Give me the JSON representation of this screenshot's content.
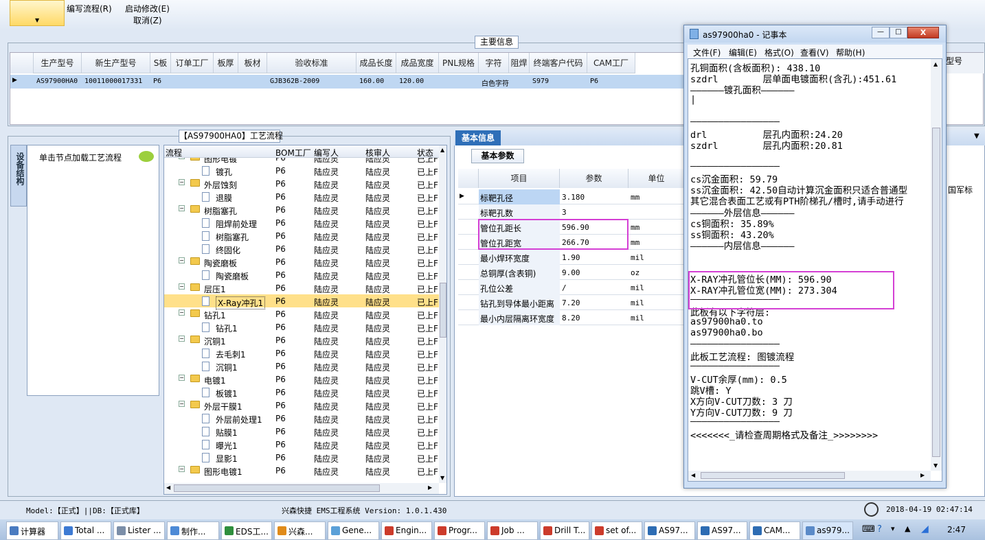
{
  "toolbar": {
    "write_flow": "编写流程(R)",
    "start_modify": "启动修改(E)",
    "cancel": "取消(Z)"
  },
  "main_info": {
    "tab": "主要信息",
    "columns": [
      "生产型号",
      "新生产型号",
      "S板",
      "订单工厂",
      "板厚",
      "板材",
      "验收标准",
      "成品长度",
      "成品宽度",
      "PNL规格",
      "字符",
      "阻焊",
      "终端客户代码",
      "CAM工厂",
      "型号"
    ],
    "row": [
      "AS97900HA0",
      "10011000017331",
      "P6",
      "",
      "",
      "",
      "GJB362B-2009",
      "160.00",
      "120.00",
      "",
      "白色字符",
      "",
      "S979",
      "P6",
      ""
    ]
  },
  "process": {
    "tab": "【AS97900HA0】工艺流程",
    "side_tab": "设备结构",
    "hint": "单击节点加载工艺流程",
    "columns": [
      "流程",
      "BOM工厂",
      "编写人",
      "核审人",
      "状态"
    ],
    "rows": [
      {
        "name": "图形电镀",
        "level": 0,
        "folder": true,
        "bom": "P6",
        "w": "陆应灵",
        "r": "陆应灵",
        "s": "已上F"
      },
      {
        "name": "镀孔",
        "level": 1,
        "folder": false,
        "bom": "P6",
        "w": "陆应灵",
        "r": "陆应灵",
        "s": "已上F"
      },
      {
        "name": "外层蚀刻",
        "level": 0,
        "folder": true,
        "bom": "P6",
        "w": "陆应灵",
        "r": "陆应灵",
        "s": "已上F"
      },
      {
        "name": "退膜",
        "level": 1,
        "folder": false,
        "bom": "P6",
        "w": "陆应灵",
        "r": "陆应灵",
        "s": "已上F"
      },
      {
        "name": "树脂塞孔",
        "level": 0,
        "folder": true,
        "bom": "P6",
        "w": "陆应灵",
        "r": "陆应灵",
        "s": "已上F"
      },
      {
        "name": "阻焊前处理",
        "level": 1,
        "folder": false,
        "bom": "P6",
        "w": "陆应灵",
        "r": "陆应灵",
        "s": "已上F"
      },
      {
        "name": "树脂塞孔",
        "level": 1,
        "folder": false,
        "bom": "P6",
        "w": "陆应灵",
        "r": "陆应灵",
        "s": "已上F"
      },
      {
        "name": "终固化",
        "level": 1,
        "folder": false,
        "bom": "P6",
        "w": "陆应灵",
        "r": "陆应灵",
        "s": "已上F"
      },
      {
        "name": "陶瓷磨板",
        "level": 0,
        "folder": true,
        "bom": "P6",
        "w": "陆应灵",
        "r": "陆应灵",
        "s": "已上F"
      },
      {
        "name": "陶瓷磨板",
        "level": 1,
        "folder": false,
        "bom": "P6",
        "w": "陆应灵",
        "r": "陆应灵",
        "s": "已上F"
      },
      {
        "name": "层压1",
        "level": 0,
        "folder": true,
        "bom": "P6",
        "w": "陆应灵",
        "r": "陆应灵",
        "s": "已上F"
      },
      {
        "name": "X-Ray冲孔1",
        "level": 1,
        "folder": false,
        "bom": "P6",
        "w": "陆应灵",
        "r": "陆应灵",
        "s": "已上F",
        "selected": true
      },
      {
        "name": "钻孔1",
        "level": 0,
        "folder": true,
        "bom": "P6",
        "w": "陆应灵",
        "r": "陆应灵",
        "s": "已上F"
      },
      {
        "name": "钻孔1",
        "level": 1,
        "folder": false,
        "bom": "P6",
        "w": "陆应灵",
        "r": "陆应灵",
        "s": "已上F"
      },
      {
        "name": "沉铜1",
        "level": 0,
        "folder": true,
        "bom": "P6",
        "w": "陆应灵",
        "r": "陆应灵",
        "s": "已上F"
      },
      {
        "name": "去毛刺1",
        "level": 1,
        "folder": false,
        "bom": "P6",
        "w": "陆应灵",
        "r": "陆应灵",
        "s": "已上F"
      },
      {
        "name": "沉铜1",
        "level": 1,
        "folder": false,
        "bom": "P6",
        "w": "陆应灵",
        "r": "陆应灵",
        "s": "已上F"
      },
      {
        "name": "电镀1",
        "level": 0,
        "folder": true,
        "bom": "P6",
        "w": "陆应灵",
        "r": "陆应灵",
        "s": "已上F"
      },
      {
        "name": "板镀1",
        "level": 1,
        "folder": false,
        "bom": "P6",
        "w": "陆应灵",
        "r": "陆应灵",
        "s": "已上F"
      },
      {
        "name": "外层干膜1",
        "level": 0,
        "folder": true,
        "bom": "P6",
        "w": "陆应灵",
        "r": "陆应灵",
        "s": "已上F"
      },
      {
        "name": "外层前处理1",
        "level": 1,
        "folder": false,
        "bom": "P6",
        "w": "陆应灵",
        "r": "陆应灵",
        "s": "已上F"
      },
      {
        "name": "贴膜1",
        "level": 1,
        "folder": false,
        "bom": "P6",
        "w": "陆应灵",
        "r": "陆应灵",
        "s": "已上F"
      },
      {
        "name": "曝光1",
        "level": 1,
        "folder": false,
        "bom": "P6",
        "w": "陆应灵",
        "r": "陆应灵",
        "s": "已上F"
      },
      {
        "name": "显影1",
        "level": 1,
        "folder": false,
        "bom": "P6",
        "w": "陆应灵",
        "r": "陆应灵",
        "s": "已上F"
      },
      {
        "name": "图形电镀1",
        "level": 0,
        "folder": true,
        "bom": "P6",
        "w": "陆应灵",
        "r": "陆应灵",
        "s": "已上F"
      }
    ]
  },
  "basic": {
    "tab": "基本信息",
    "subtab": "基本参数",
    "columns": [
      "项目",
      "参数",
      "单位"
    ],
    "rows": [
      [
        "标靶孔径",
        "3.180",
        "mm"
      ],
      [
        "标靶孔数",
        "3",
        ""
      ],
      [
        "管位孔距长",
        "596.90",
        "mm"
      ],
      [
        "管位孔距宽",
        "266.70",
        "mm"
      ],
      [
        "最小焊环宽度",
        "1.90",
        "mil"
      ],
      [
        "总铜厚(含表铜)",
        "9.00",
        "oz"
      ],
      [
        "孔位公差",
        "/",
        "mil"
      ],
      [
        "钻孔到导体最小距离",
        "7.20",
        "mil"
      ],
      [
        "最小内层隔离环宽度",
        "8.20",
        "mil"
      ]
    ],
    "right_text": "国军标"
  },
  "notepad": {
    "title": "as97900ha0 - 记事本",
    "menu": [
      "文件(F)",
      "编辑(E)",
      "格式(O)",
      "查看(V)",
      "帮助(H)"
    ],
    "lines": [
      "孔铜面积(含板面积): 438.10",
      "szdrl        层单面电镀面积(含孔):451.61",
      "——————镀孔面积——————",
      "|",
      "",
      "————————————————",
      "drl          层孔内面积:24.20",
      "szdrl        层孔内面积:20.81",
      "",
      "————————————————",
      "cs沉金面积: 59.79",
      "ss沉金面积: 42.50自动计算沉金面积只适合普通型",
      "其它混合表面工艺或有PTH阶梯孔/槽时,请手动进行",
      "——————外层信息——————",
      "cs铜面积: 35.89%",
      "ss铜面积: 43.20%",
      "——————内层信息——————",
      "",
      "",
      "X-RAY冲孔管位长(MM): 596.90",
      "X-RAY冲孔管位宽(MM): 273.304",
      "————————————————",
      "此板有以下字符层:",
      "as97900ha0.to",
      "as97900ha0.bo",
      "————————————————",
      "此板工艺流程: 图镀流程",
      "————————————————",
      "V-CUT余厚(mm): 0.5",
      "跳V槽: Y",
      "X方向V-CUT刀数: 3 刀",
      "Y方向V-CUT刀数: 9 刀",
      "————————————————",
      "<<<<<<<_请检查周期格式及备注_>>>>>>>>"
    ]
  },
  "status": {
    "left": "Model:【正式】||DB:【正式库】",
    "center": "兴森快捷 EMS工程系统 Version: 1.0.1.430",
    "datetime": "2018-04-19 02:47:14"
  },
  "taskbar": {
    "items": [
      "计算器",
      "Total ...",
      "Lister ...",
      "制作...",
      "EDS工...",
      "兴森...",
      "Gene...",
      "Engin...",
      "Progr...",
      "Job ...",
      "Drill T...",
      "set of...",
      "AS97...",
      "AS97...",
      "CAM...",
      "as979..."
    ],
    "time": "2:47"
  }
}
